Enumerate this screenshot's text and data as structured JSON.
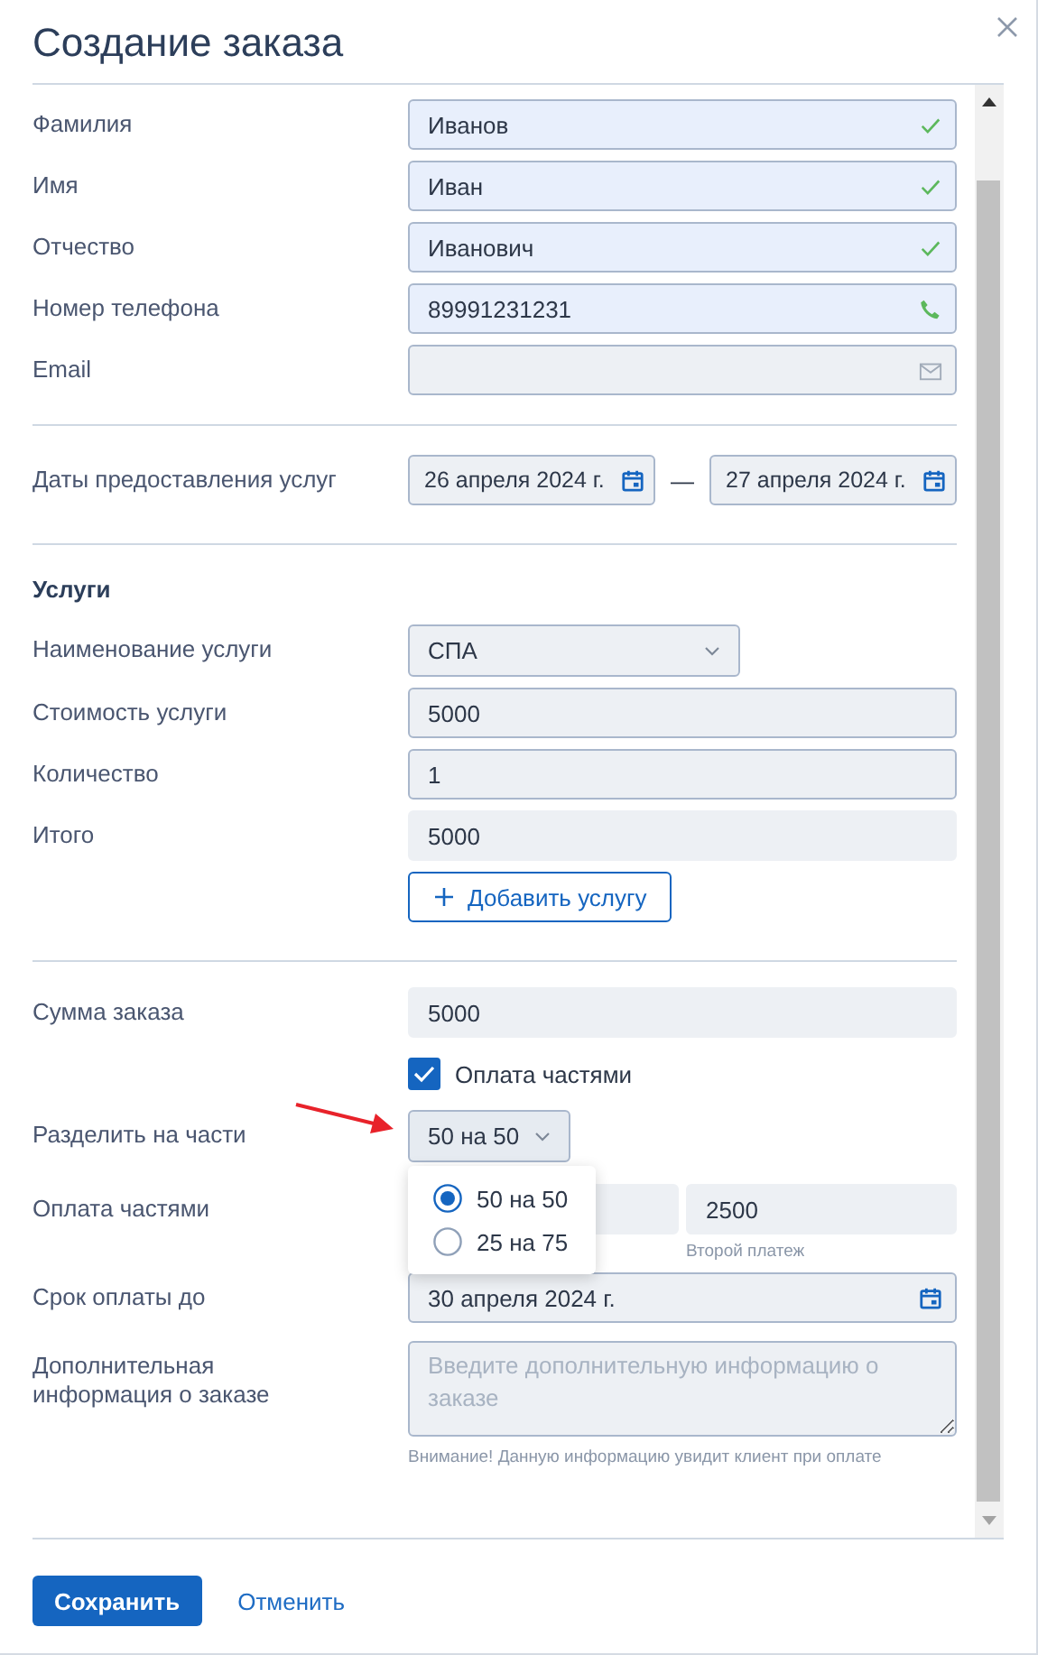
{
  "dialog": {
    "title": "Создание заказа"
  },
  "sections": [
    {
      "rows": [
        {
          "kind": "text",
          "label": "Фамилия",
          "value": "Иванов",
          "valid": true
        },
        {
          "kind": "text",
          "label": "Имя",
          "value": "Иван",
          "valid": true
        },
        {
          "kind": "text",
          "label": "Отчество",
          "value": "Иванович",
          "valid": true
        },
        {
          "kind": "phone",
          "label": "Номер телефона",
          "value": "89991231231",
          "valid": true
        },
        {
          "kind": "email",
          "label": "Email",
          "valid": false
        }
      ]
    },
    {
      "rows": [
        {
          "kind": "date_range",
          "label": "Даты предоставления услуг",
          "from": "26 апреля 2024 г.",
          "separator": "—",
          "to": "27 апреля 2024 г."
        }
      ]
    },
    {
      "rows": [
        {
          "kind": "heading",
          "label": "Услуги"
        },
        {
          "kind": "select",
          "label": "Наименование услуги",
          "value": "СПА"
        },
        {
          "kind": "text",
          "label": "Стоимость услуги",
          "value": "5000",
          "valid": false
        },
        {
          "kind": "text",
          "label": "Количество",
          "value": "1",
          "valid": false
        },
        {
          "kind": "text",
          "label": "Итого",
          "value": "5000",
          "disabled": true
        },
        {
          "kind": "button",
          "label": "Добавить услугу"
        }
      ]
    },
    {
      "rows": [
        {
          "kind": "text",
          "label": "Сумма заказа",
          "value": "5000",
          "disabled": true
        },
        {
          "kind": "checkbox",
          "label": "Оплата частями",
          "checked": true
        },
        {
          "kind": "select",
          "label": "Разделить на части",
          "value": "50 на 50",
          "options": [
            {
              "label": "50 на 50",
              "selected": true
            },
            {
              "label": "25 на 75",
              "selected": false
            }
          ]
        },
        {
          "kind": "parts",
          "label": "Оплата частями",
          "fields": [
            {
              "disabled": true
            },
            {
              "value": "2500",
              "caption": "Второй платеж",
              "disabled": true
            }
          ]
        },
        {
          "kind": "date",
          "label": "Срок оплаты до",
          "value": "30 апреля 2024 г."
        },
        {
          "kind": "textarea",
          "label": "Дополнительная информация о заказе",
          "placeholder": "Введите дополнительную информацию о заказе",
          "note": "Внимание! Данную информацию увидит клиент при оплате"
        }
      ]
    }
  ],
  "footer": [
    {
      "kind": "primary",
      "label": "Сохранить"
    },
    {
      "kind": "link",
      "label": "Отменить"
    }
  ]
}
